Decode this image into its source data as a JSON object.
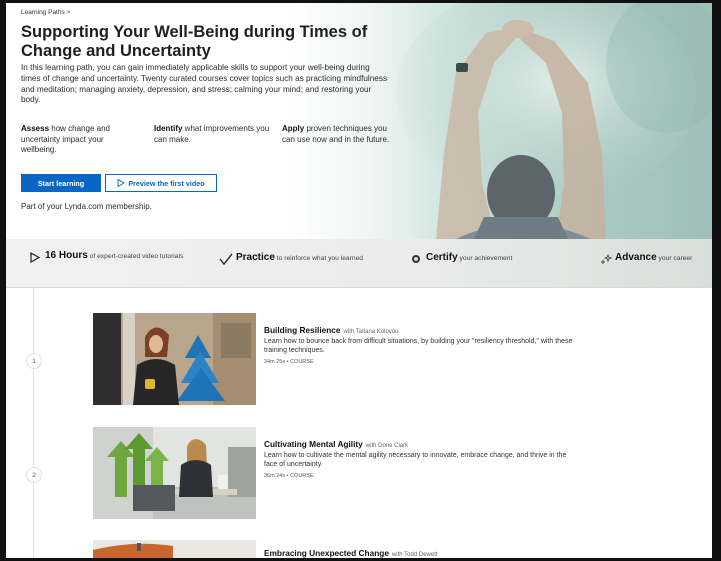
{
  "breadcrumb": "Learning Paths  >",
  "title": "Supporting Your Well-Being during Times of Change and Uncertainty",
  "description": "In this learning path, you can gain immediately applicable skills to support your well-being during times of change and uncertainty. Twenty curated courses cover topics such as practicing mindfulness and meditation; managing anxiety, depression, and stress; calming your mind; and restoring your body.",
  "features": [
    {
      "bold": "Assess",
      "text": " how change and uncertainty impact your wellbeing."
    },
    {
      "bold": "Identify",
      "text": " what improvements you can make."
    },
    {
      "bold": "Apply",
      "text": " proven techniques you can use now and in the future."
    }
  ],
  "buttons": {
    "start": "Start learning",
    "preview": "Preview the first video"
  },
  "membership": "Part of your Lynda.com membership.",
  "band": [
    {
      "bold": "16 Hours",
      "text": " of expert-created video tutorials",
      "icon": "play-outline-icon"
    },
    {
      "bold": "Practice",
      "text": " to reinforce what you learned",
      "icon": "checkmark-icon"
    },
    {
      "bold": "Certify",
      "text": " your achievement",
      "icon": "certificate-icon"
    },
    {
      "bold": "Advance",
      "text": " your career",
      "icon": "sparkle-icon"
    }
  ],
  "courses": [
    {
      "num": "1",
      "title": "Building Resilience",
      "with": "with Tatiana Kolovou",
      "desc": "Learn how to bounce back from difficult situations, by building your \"resiliency threshold,\" with these training techniques.",
      "meta": "34m 25s • COURSE"
    },
    {
      "num": "2",
      "title": "Cultivating Mental Agility",
      "with": "with Dorie Clark",
      "desc": "Learn how to cultivate the mental agility necessary to innovate, embrace change, and thrive in the face of uncertainty.",
      "meta": "36m 24s • COURSE"
    },
    {
      "title": "Embracing Unexpected Change",
      "with": "with Todd Dewett"
    }
  ],
  "colors": {
    "accent": "#0a66c2",
    "hero_teal": "#a9c9c1"
  }
}
